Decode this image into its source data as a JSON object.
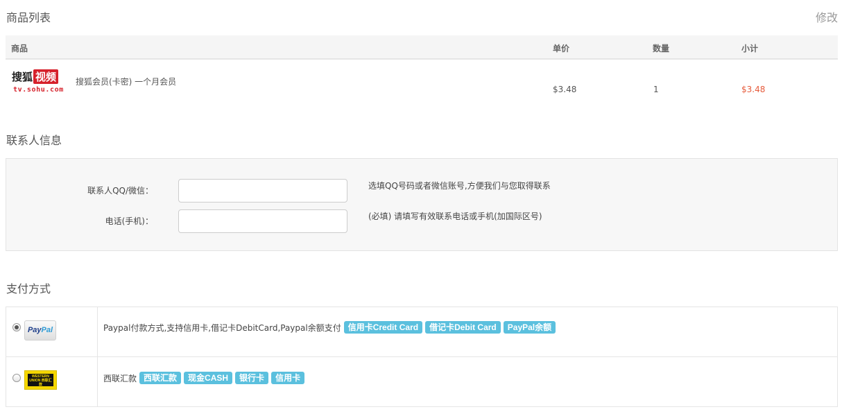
{
  "products": {
    "title": "商品列表",
    "edit_label": "修改",
    "columns": {
      "product": "商品",
      "price": "单价",
      "qty": "数量",
      "subtotal": "小计"
    },
    "items": [
      {
        "logo_text": "搜狐",
        "logo_highlight": "视频",
        "logo_url": "tv.sohu.com",
        "name": "搜狐会员(卡密) 一个月会员",
        "price": "$3.48",
        "qty": "1",
        "subtotal": "$3.48"
      }
    ]
  },
  "contact": {
    "title": "联系人信息",
    "qq_label": "联系人QQ/微信：",
    "qq_value": "",
    "qq_hint": "选填QQ号码或者微信账号,方便我们与您取得联系",
    "phone_label": "电话(手机)：",
    "phone_value": "",
    "phone_hint": "(必填) 请填写有效联系电话或手机(加国际区号)"
  },
  "payment": {
    "title": "支付方式",
    "methods": [
      {
        "id": "paypal",
        "checked": true,
        "logo_pay": "Pay",
        "logo_pal": "Pal",
        "description": "Paypal付款方式,支持信用卡,借记卡DebitCard,Paypal余额支付",
        "tags": [
          "信用卡Credit Card",
          "借记卡Debit Card",
          "PayPal余额"
        ]
      },
      {
        "id": "western-union",
        "checked": false,
        "logo_text": "WESTERN UNION 西联汇款",
        "description": "西联汇款",
        "tags": [
          "西联汇款",
          "现金CASH",
          "银行卡",
          "信用卡"
        ]
      }
    ]
  },
  "colors": {
    "accent_tag": "#5bc0de",
    "subtotal": "#e65c3c",
    "sohu_red": "#d6212b",
    "wu_yellow": "#f5d700"
  }
}
